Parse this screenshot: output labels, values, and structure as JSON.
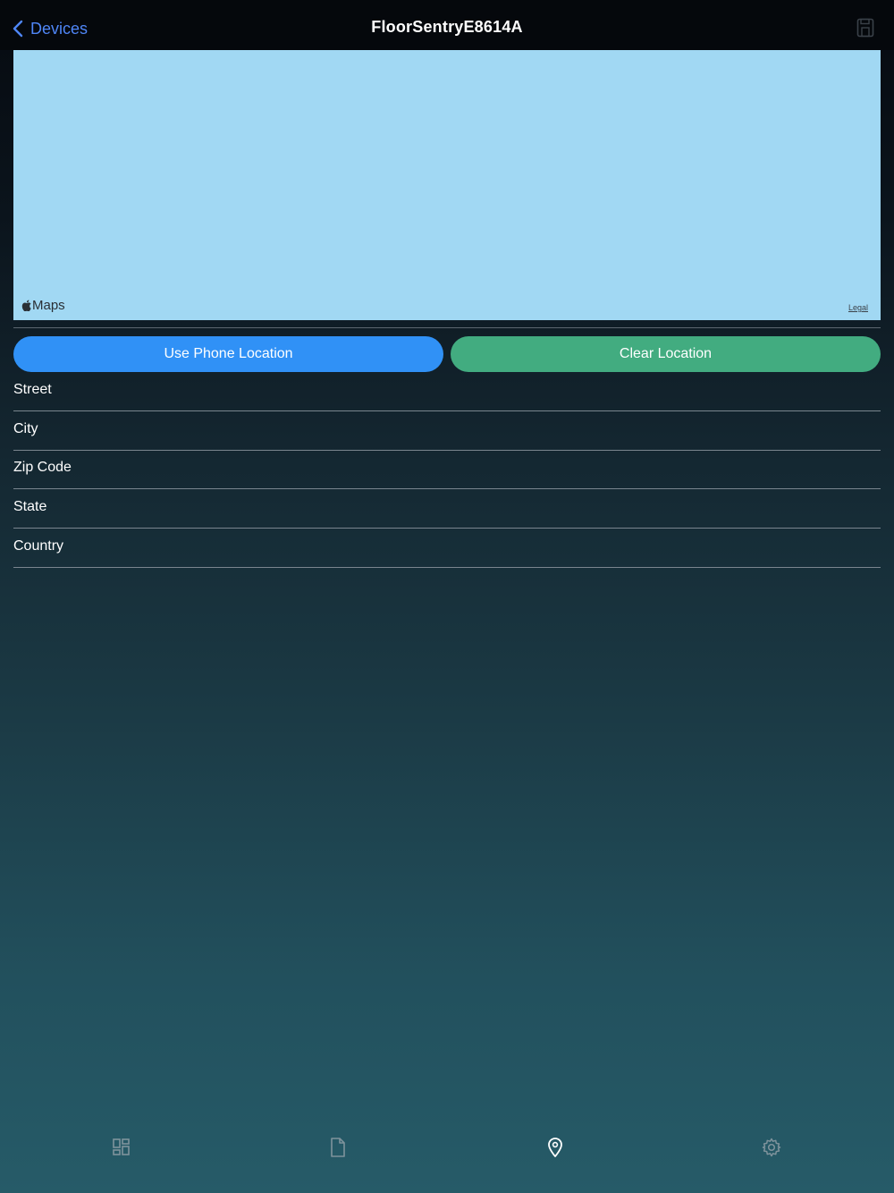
{
  "nav": {
    "back_label": "Devices",
    "title": "FloorSentryE8614A",
    "save_icon": "save-icon"
  },
  "map": {
    "brand": "Maps",
    "legal": "Legal",
    "background_color": "#a1d8f3"
  },
  "actions": {
    "use_phone_location": "Use Phone Location",
    "clear_location": "Clear Location",
    "phone_color": "#3091f6",
    "clear_color": "#42ac80"
  },
  "form": {
    "street": {
      "placeholder": "Street",
      "value": ""
    },
    "city": {
      "placeholder": "City",
      "value": ""
    },
    "zip": {
      "placeholder": "Zip Code",
      "value": ""
    },
    "state": {
      "placeholder": "State",
      "value": ""
    },
    "country": {
      "placeholder": "Country",
      "value": ""
    }
  },
  "tabs": [
    {
      "icon": "dashboard-grid-icon",
      "selected": false
    },
    {
      "icon": "document-icon",
      "selected": false
    },
    {
      "icon": "location-pin-icon",
      "selected": true
    },
    {
      "icon": "gear-icon",
      "selected": false
    }
  ],
  "colors": {
    "accent": "#4f86f7",
    "tab_inactive": "#7f939c",
    "tab_active": "#ffffff"
  }
}
